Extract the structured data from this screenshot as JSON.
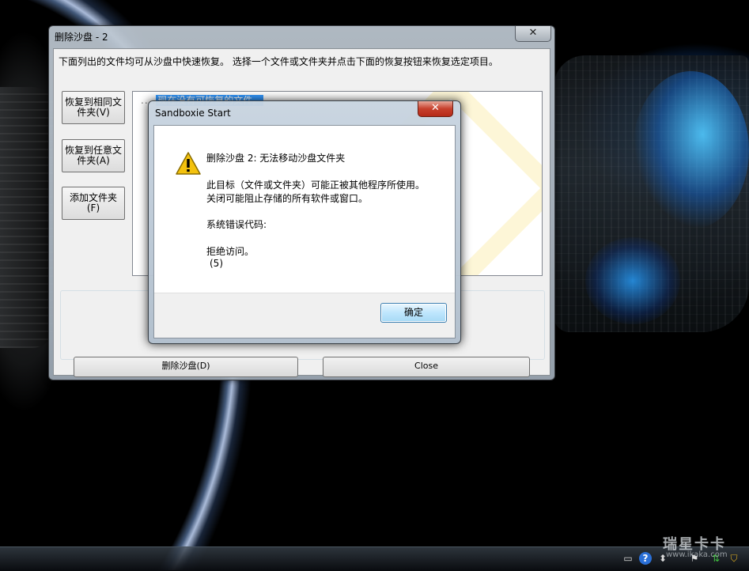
{
  "main_window": {
    "title": "删除沙盘 - 2",
    "close_glyph": "✕",
    "instruction": "下面列出的文件均可从沙盘中快速恢复。 选择一个文件或文件夹并点击下面的恢复按钮来恢复选定项目。",
    "buttons": {
      "restore_same": "恢复到相同文件夹(V)",
      "restore_any": "恢复到任意文件夹(A)",
      "add_folder": "添加文件夹(F)"
    },
    "file_list": {
      "tree_prefix": "....",
      "selected_item": "现在没有可恢复的文件。"
    },
    "delete_sandbox_button": "删除沙盘(D)",
    "close_button": "Close"
  },
  "dialog": {
    "title": "Sandboxie Start",
    "close_glyph": "✕",
    "icon": "warning-icon",
    "line1": "删除沙盘 2:  无法移动沙盘文件夹",
    "line2": "此目标（文件或文件夹）可能正被其他程序所使用。",
    "line3": "关闭可能阻止存储的所有软件或窗口。",
    "line4": "系统错误代码:",
    "line5": "拒绝访问。",
    "line6": "(5)",
    "ok_button": "确定"
  },
  "taskbar": {
    "icons": [
      "keyboard-icon",
      "help-icon",
      "arrow-icon",
      "flag-icon",
      "network-icon",
      "shield-icon"
    ]
  },
  "watermark": {
    "brand": "瑞星卡卡",
    "url": "www.ikaka.com"
  }
}
